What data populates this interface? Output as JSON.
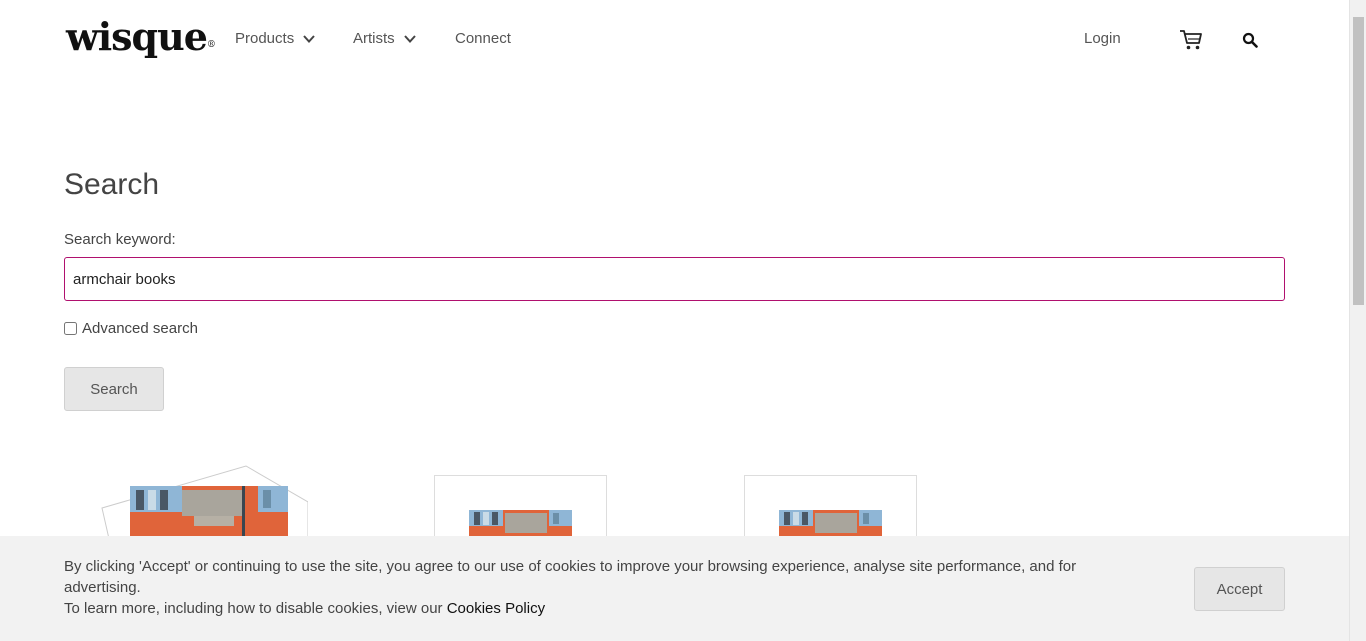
{
  "header": {
    "logo_text": "wisque",
    "nav": [
      {
        "label": "Products"
      },
      {
        "label": "Artists"
      },
      {
        "label": "Connect"
      }
    ],
    "login_label": "Login",
    "cart_icon": "cart-icon",
    "search_icon": "search-icon"
  },
  "main": {
    "title": "Search",
    "keyword_label": "Search keyword:",
    "keyword_value": "armchair books",
    "advanced_label": "Advanced search",
    "advanced_checked": false,
    "search_button": "Search"
  },
  "cookie": {
    "text_line1": "By clicking 'Accept' or continuing to use the site, you agree to our use of cookies to improve your browsing experience, analyse site performance, and for advertising.",
    "text_line2_prefix": "To learn more, including how to disable cookies, view our ",
    "policy_link": "Cookies Policy",
    "accept_button": "Accept"
  },
  "colors": {
    "accent": "#b0106e",
    "brick": "#e0643a",
    "stone": "#a9a59c"
  }
}
